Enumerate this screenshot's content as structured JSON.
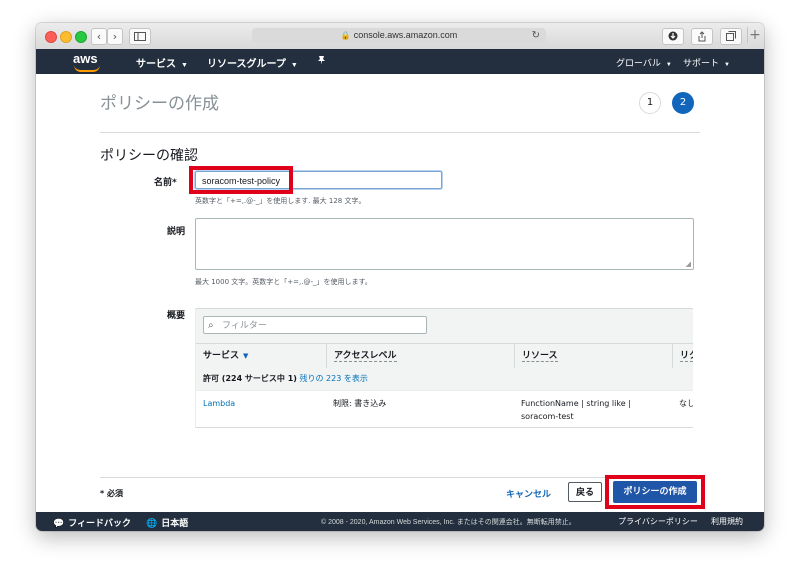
{
  "browser": {
    "back_glyph": "‹",
    "forward_glyph": "›",
    "address": "console.aws.amazon.com",
    "new_tab_glyph": "+"
  },
  "nav": {
    "logo": "aws",
    "services": "サービス",
    "resource_groups": "リソースグループ",
    "pin_icon": "pin-icon",
    "global": "グローバル",
    "support": "サポート"
  },
  "page": {
    "title": "ポリシーの作成",
    "steps": [
      "1",
      "2"
    ],
    "section_title": "ポリシーの確認"
  },
  "form": {
    "name_label": "名前*",
    "name_value": "soracom-test-policy",
    "name_help": "英数字と「+=,.@-_」を使用します. 最大 128 文字。",
    "description_label": "説明",
    "description_value": "",
    "description_help": "最大 1000 文字。英数字と「+=,.@-_」を使用します。",
    "summary_label": "概要"
  },
  "summary": {
    "filter_placeholder": "フィルター",
    "columns": [
      "サービス",
      "アクセスレベル",
      "リソース",
      "リク"
    ],
    "group_prefix": "許可 (224 サービス中 1)",
    "group_link": "残りの 223 を表示",
    "rows": [
      {
        "service": "Lambda",
        "access_level": "制限: 書き込み",
        "resource_line1": "FunctionName | string like |",
        "resource_line2": "soracom-test",
        "request_condition": "なし"
      }
    ]
  },
  "footer": {
    "required_note": "* 必須",
    "cancel": "キャンセル",
    "back": "戻る",
    "create": "ポリシーの作成"
  },
  "bottombar": {
    "feedback": "フィードバック",
    "language": "日本語",
    "copyright": "© 2008 - 2020, Amazon Web Services, Inc. またはその関連会社。無断転用禁止。",
    "privacy": "プライバシーポリシー",
    "terms": "利用規約"
  },
  "colors": {
    "nav_bg": "#232f3e",
    "primary_button": "#1f56a8",
    "link": "#0073bb",
    "highlight_box": "#e0001a"
  }
}
